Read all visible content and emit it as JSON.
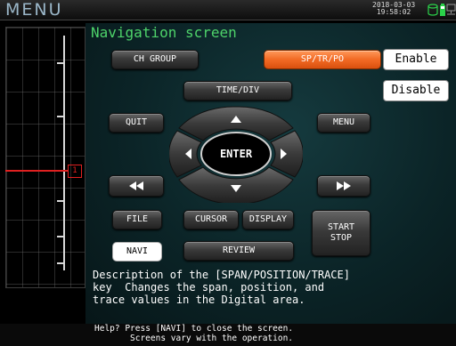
{
  "topbar": {
    "menu_label": "MENU",
    "date": "2018-03-03",
    "time": "19:58:02"
  },
  "panel": {
    "title": "Navigation screen",
    "buttons": {
      "ch_group": "CH GROUP",
      "sp_tr_po": "SP/TR/PO",
      "enable": "Enable",
      "disable": "Disable",
      "time_div": "TIME/DIV",
      "quit": "QUIT",
      "menu": "MENU",
      "enter": "ENTER",
      "file": "FILE",
      "cursor": "CURSOR",
      "display": "DISPLAY",
      "start": "START",
      "stop": "STOP",
      "navi": "NAVI",
      "review": "REVIEW"
    },
    "description": "Description of the [SPAN/POSITION/TRACE]\nkey  Changes the span, position, and\ntrace values in the Digital area."
  },
  "graph": {
    "marker": "1",
    "trace_color": "#e02020"
  },
  "help": {
    "line1": "Help? Press [NAVI] to close the screen.",
    "line2": "Screens vary with the operation."
  },
  "colors": {
    "title_green": "#4ed36a",
    "active_orange": "#f26a24",
    "panel_teal": "#0b2427"
  },
  "icons": [
    "storage-icon",
    "battery-icon",
    "network-icon",
    "up-arrow-icon",
    "down-arrow-icon",
    "left-arrow-icon",
    "right-arrow-icon",
    "rewind-icon",
    "fast-forward-icon"
  ]
}
